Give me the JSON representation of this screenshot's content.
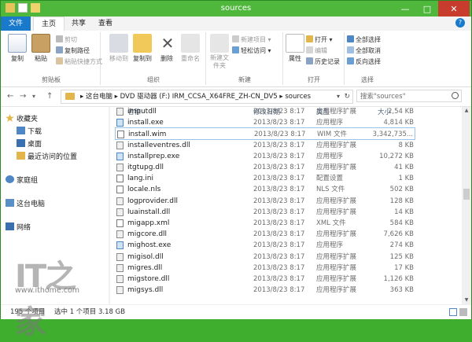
{
  "window": {
    "title": "sources",
    "minimize_glyph": "—",
    "maximize_glyph": "□",
    "close_glyph": "✕"
  },
  "tabs": [
    {
      "label": "文件"
    },
    {
      "label": "主页"
    },
    {
      "label": "共享"
    },
    {
      "label": "查看"
    }
  ],
  "help_glyph": "?",
  "ribbon": {
    "clipboard": {
      "label": "剪贴板",
      "copy": "复制",
      "paste": "粘贴",
      "cut": "剪切",
      "copy_path": "复制路径",
      "paste_shortcut": "粘贴快捷方式"
    },
    "organize": {
      "label": "组织",
      "move_to": "移动到",
      "copy_to": "复制到",
      "delete": "删除",
      "rename": "重命名"
    },
    "new": {
      "label": "新建",
      "new_folder": "新建文件夹",
      "new_item": "新建项目 ▾",
      "easy_access": "轻松访问 ▾"
    },
    "open": {
      "label": "打开",
      "properties": "属性",
      "open": "打开 ▾",
      "edit": "编辑",
      "history": "历史记录"
    },
    "select": {
      "label": "选择",
      "select_all": "全部选择",
      "select_none": "全部取消",
      "invert": "反向选择"
    }
  },
  "address": {
    "back": "←",
    "forward": "→",
    "dropdown": "▾",
    "up": "↑",
    "crumbs": "▸  这台电脑  ▸  DVD 驱动器 (F:) IRM_CCSA_X64FRE_ZH-CN_DV5  ▸  sources",
    "refresh": "↻",
    "search_placeholder": "搜索\"sources\""
  },
  "navpane": {
    "favorites": "收藏夹",
    "downloads": "下载",
    "desktop": "桌面",
    "recent": "最近访问的位置",
    "homegroup": "家庭组",
    "this_pc": "这台电脑",
    "network": "网络"
  },
  "columns": {
    "name": "名称",
    "date": "修改日期",
    "type": "类型",
    "size": "大小"
  },
  "files": [
    {
      "name": "imputdll",
      "date": "2013/8/23 8:17",
      "type": "应用程序扩展",
      "size": "2,54 KB",
      "kind": "dll"
    },
    {
      "name": "install.exe",
      "date": "2013/8/23 8:17",
      "type": "应用程序",
      "size": "4,814 KB",
      "kind": "exe"
    },
    {
      "name": "install.wim",
      "date": "2013/8/23 8:17",
      "type": "WIM 文件",
      "size": "3,342,735...",
      "kind": "file"
    },
    {
      "name": "installeventres.dll",
      "date": "2013/8/23 8:17",
      "type": "应用程序扩展",
      "size": "8 KB",
      "kind": "dll"
    },
    {
      "name": "installprep.exe",
      "date": "2013/8/23 8:17",
      "type": "应用程序",
      "size": "10,272 KB",
      "kind": "exe"
    },
    {
      "name": "itgtupg.dll",
      "date": "2013/8/23 8:17",
      "type": "应用程序扩展",
      "size": "41 KB",
      "kind": "dll"
    },
    {
      "name": "lang.ini",
      "date": "2013/8/23 8:17",
      "type": "配置设置",
      "size": "1 KB",
      "kind": "file"
    },
    {
      "name": "locale.nls",
      "date": "2013/8/23 8:17",
      "type": "NLS 文件",
      "size": "502 KB",
      "kind": "file"
    },
    {
      "name": "logprovider.dll",
      "date": "2013/8/23 8:17",
      "type": "应用程序扩展",
      "size": "128 KB",
      "kind": "dll"
    },
    {
      "name": "luainstall.dll",
      "date": "2013/8/23 8:17",
      "type": "应用程序扩展",
      "size": "14 KB",
      "kind": "dll"
    },
    {
      "name": "migapp.xml",
      "date": "2013/8/23 8:17",
      "type": "XML 文件",
      "size": "584 KB",
      "kind": "file"
    },
    {
      "name": "migcore.dll",
      "date": "2013/8/23 8:17",
      "type": "应用程序扩展",
      "size": "7,626 KB",
      "kind": "dll"
    },
    {
      "name": "mighost.exe",
      "date": "2013/8/23 8:17",
      "type": "应用程序",
      "size": "274 KB",
      "kind": "exe"
    },
    {
      "name": "migisol.dll",
      "date": "2013/8/23 8:17",
      "type": "应用程序扩展",
      "size": "125 KB",
      "kind": "dll"
    },
    {
      "name": "migres.dll",
      "date": "2013/8/23 8:17",
      "type": "应用程序扩展",
      "size": "17 KB",
      "kind": "dll"
    },
    {
      "name": "migstore.dll",
      "date": "2013/8/23 8:17",
      "type": "应用程序扩展",
      "size": "1,126 KB",
      "kind": "dll"
    },
    {
      "name": "migsys.dll",
      "date": "2013/8/23 8:17",
      "type": "应用程序扩展",
      "size": "363 KB",
      "kind": "dll"
    }
  ],
  "selected_index": 2,
  "status": {
    "count": "195 个项目",
    "selection": "选中 1 个项目  3.18 GB"
  },
  "watermark": {
    "logo_text": "IT之家",
    "url": "www.ithome.com"
  },
  "colors": {
    "titlebar": "#4fb83c",
    "file_tab": "#1979ca",
    "close": "#c83c2e",
    "selection_border": "#99c4e8"
  }
}
